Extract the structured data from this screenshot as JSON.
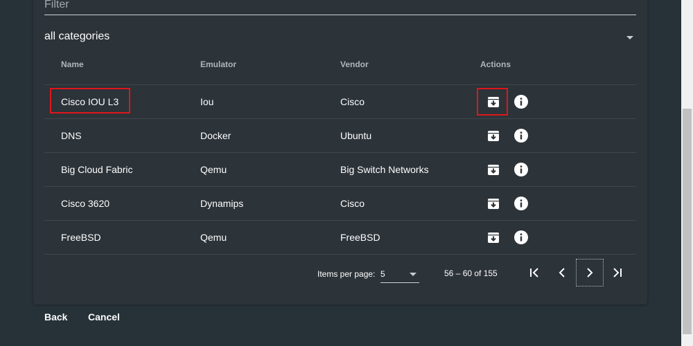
{
  "filter": {
    "label": "Filter"
  },
  "category": {
    "selected": "all categories"
  },
  "table": {
    "columns": [
      "Name",
      "Emulator",
      "Vendor",
      "Actions"
    ],
    "rows": [
      {
        "name": "Cisco IOU L3",
        "emulator": "Iou",
        "vendor": "Cisco"
      },
      {
        "name": "DNS",
        "emulator": "Docker",
        "vendor": "Ubuntu"
      },
      {
        "name": "Big Cloud Fabric",
        "emulator": "Qemu",
        "vendor": "Big Switch Networks"
      },
      {
        "name": "Cisco 3620",
        "emulator": "Dynamips",
        "vendor": "Cisco"
      },
      {
        "name": "FreeBSD",
        "emulator": "Qemu",
        "vendor": "FreeBSD"
      }
    ],
    "row_icons": {
      "install": "archive-icon",
      "info": "info-icon"
    }
  },
  "paginator": {
    "items_per_page_label": "Items per page:",
    "items_per_page_value": "5",
    "range_label": "56 – 60 of 155"
  },
  "footer": {
    "back_label": "Back",
    "cancel_label": "Cancel"
  },
  "colors": {
    "background": "#263238",
    "card": "#2c3339",
    "text": "#ffffff",
    "highlight": "#e0161a"
  }
}
